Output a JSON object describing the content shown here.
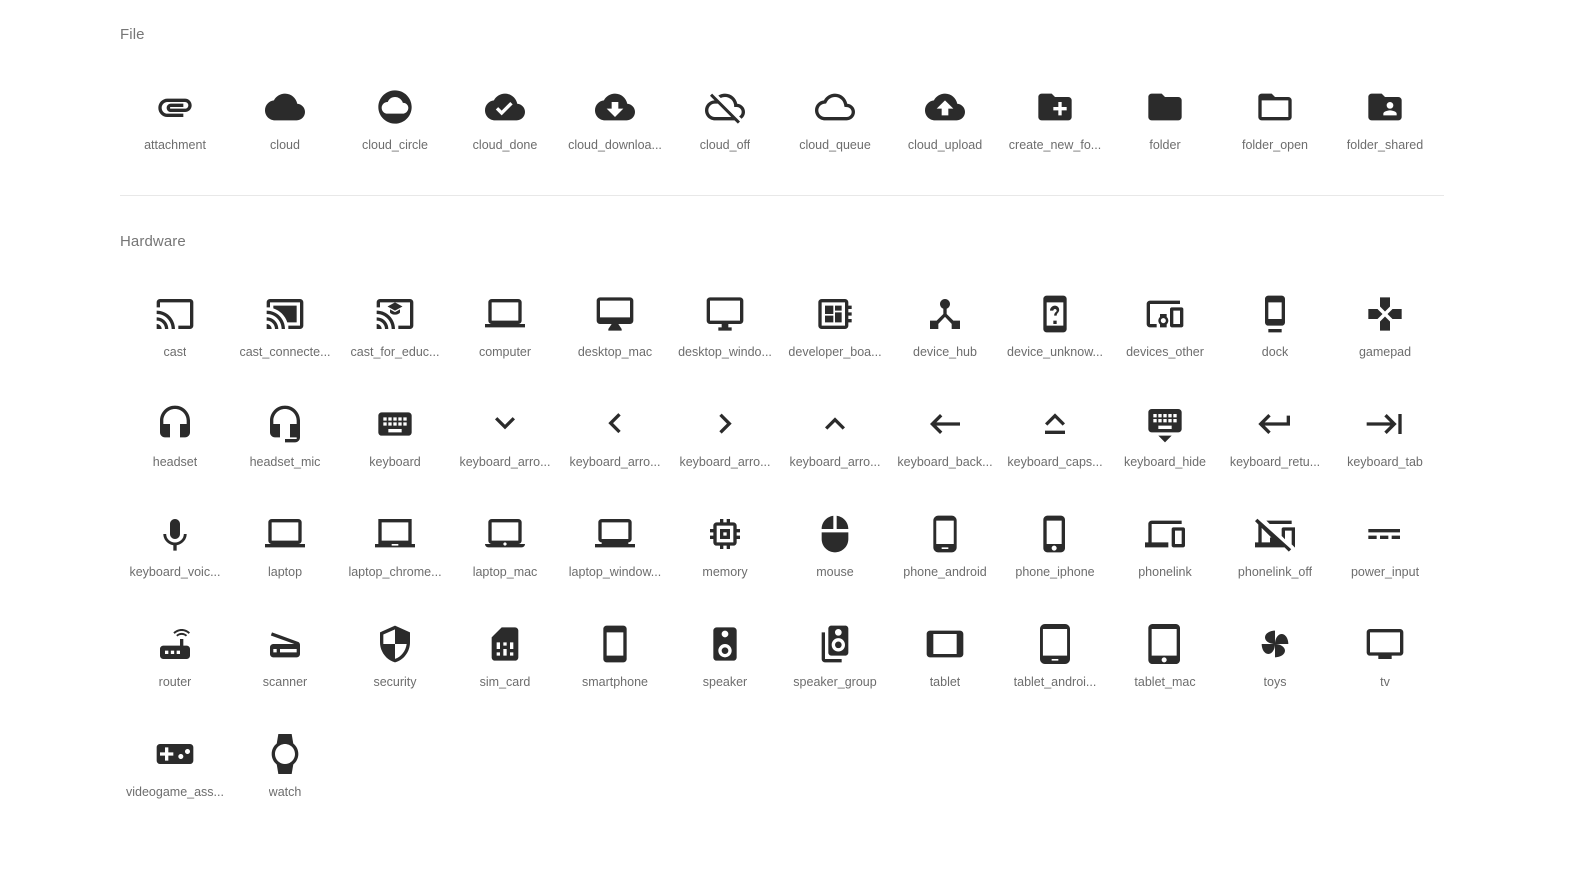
{
  "page": {
    "background_color": "#ffffff",
    "icon_color": "#2b2b2b",
    "label_color": "#6d6d6d",
    "section_title_color": "#767676",
    "divider_color": "#e8e8e8"
  },
  "sections": [
    {
      "title": "File",
      "icons": [
        {
          "label": "attachment",
          "icon": "attachment-icon"
        },
        {
          "label": "cloud",
          "icon": "cloud-icon"
        },
        {
          "label": "cloud_circle",
          "icon": "cloud-circle-icon"
        },
        {
          "label": "cloud_done",
          "icon": "cloud-done-icon"
        },
        {
          "label": "cloud_downloa...",
          "icon": "cloud-download-icon"
        },
        {
          "label": "cloud_off",
          "icon": "cloud-off-icon"
        },
        {
          "label": "cloud_queue",
          "icon": "cloud-queue-icon"
        },
        {
          "label": "cloud_upload",
          "icon": "cloud-upload-icon"
        },
        {
          "label": "create_new_fo...",
          "icon": "create-new-folder-icon"
        },
        {
          "label": "folder",
          "icon": "folder-icon"
        },
        {
          "label": "folder_open",
          "icon": "folder-open-icon"
        },
        {
          "label": "folder_shared",
          "icon": "folder-shared-icon"
        }
      ]
    },
    {
      "title": "Hardware",
      "icons": [
        {
          "label": "cast",
          "icon": "cast-icon"
        },
        {
          "label": "cast_connecte...",
          "icon": "cast-connected-icon"
        },
        {
          "label": "cast_for_educ...",
          "icon": "cast-for-education-icon"
        },
        {
          "label": "computer",
          "icon": "computer-icon"
        },
        {
          "label": "desktop_mac",
          "icon": "desktop-mac-icon"
        },
        {
          "label": "desktop_windo...",
          "icon": "desktop-windows-icon"
        },
        {
          "label": "developer_boa...",
          "icon": "developer-board-icon"
        },
        {
          "label": "device_hub",
          "icon": "device-hub-icon"
        },
        {
          "label": "device_unknow...",
          "icon": "device-unknown-icon"
        },
        {
          "label": "devices_other",
          "icon": "devices-other-icon"
        },
        {
          "label": "dock",
          "icon": "dock-icon"
        },
        {
          "label": "gamepad",
          "icon": "gamepad-icon"
        },
        {
          "label": "headset",
          "icon": "headset-icon"
        },
        {
          "label": "headset_mic",
          "icon": "headset-mic-icon"
        },
        {
          "label": "keyboard",
          "icon": "keyboard-icon"
        },
        {
          "label": "keyboard_arro...",
          "icon": "keyboard-arrow-down-icon"
        },
        {
          "label": "keyboard_arro...",
          "icon": "keyboard-arrow-left-icon"
        },
        {
          "label": "keyboard_arro...",
          "icon": "keyboard-arrow-right-icon"
        },
        {
          "label": "keyboard_arro...",
          "icon": "keyboard-arrow-up-icon"
        },
        {
          "label": "keyboard_back...",
          "icon": "keyboard-backspace-icon"
        },
        {
          "label": "keyboard_caps...",
          "icon": "keyboard-capslock-icon"
        },
        {
          "label": "keyboard_hide",
          "icon": "keyboard-hide-icon"
        },
        {
          "label": "keyboard_retu...",
          "icon": "keyboard-return-icon"
        },
        {
          "label": "keyboard_tab",
          "icon": "keyboard-tab-icon"
        },
        {
          "label": "keyboard_voic...",
          "icon": "keyboard-voice-icon"
        },
        {
          "label": "laptop",
          "icon": "laptop-icon"
        },
        {
          "label": "laptop_chrome...",
          "icon": "laptop-chromebook-icon"
        },
        {
          "label": "laptop_mac",
          "icon": "laptop-mac-icon"
        },
        {
          "label": "laptop_window...",
          "icon": "laptop-windows-icon"
        },
        {
          "label": "memory",
          "icon": "memory-icon"
        },
        {
          "label": "mouse",
          "icon": "mouse-icon"
        },
        {
          "label": "phone_android",
          "icon": "phone-android-icon"
        },
        {
          "label": "phone_iphone",
          "icon": "phone-iphone-icon"
        },
        {
          "label": "phonelink",
          "icon": "phonelink-icon"
        },
        {
          "label": "phonelink_off",
          "icon": "phonelink-off-icon"
        },
        {
          "label": "power_input",
          "icon": "power-input-icon"
        },
        {
          "label": "router",
          "icon": "router-icon"
        },
        {
          "label": "scanner",
          "icon": "scanner-icon"
        },
        {
          "label": "security",
          "icon": "security-icon"
        },
        {
          "label": "sim_card",
          "icon": "sim-card-icon"
        },
        {
          "label": "smartphone",
          "icon": "smartphone-icon"
        },
        {
          "label": "speaker",
          "icon": "speaker-icon"
        },
        {
          "label": "speaker_group",
          "icon": "speaker-group-icon"
        },
        {
          "label": "tablet",
          "icon": "tablet-icon"
        },
        {
          "label": "tablet_androi...",
          "icon": "tablet-android-icon"
        },
        {
          "label": "tablet_mac",
          "icon": "tablet-mac-icon"
        },
        {
          "label": "toys",
          "icon": "toys-icon"
        },
        {
          "label": "tv",
          "icon": "tv-icon"
        },
        {
          "label": "videogame_ass...",
          "icon": "videogame-asset-icon"
        },
        {
          "label": "watch",
          "icon": "watch-icon"
        }
      ]
    }
  ]
}
